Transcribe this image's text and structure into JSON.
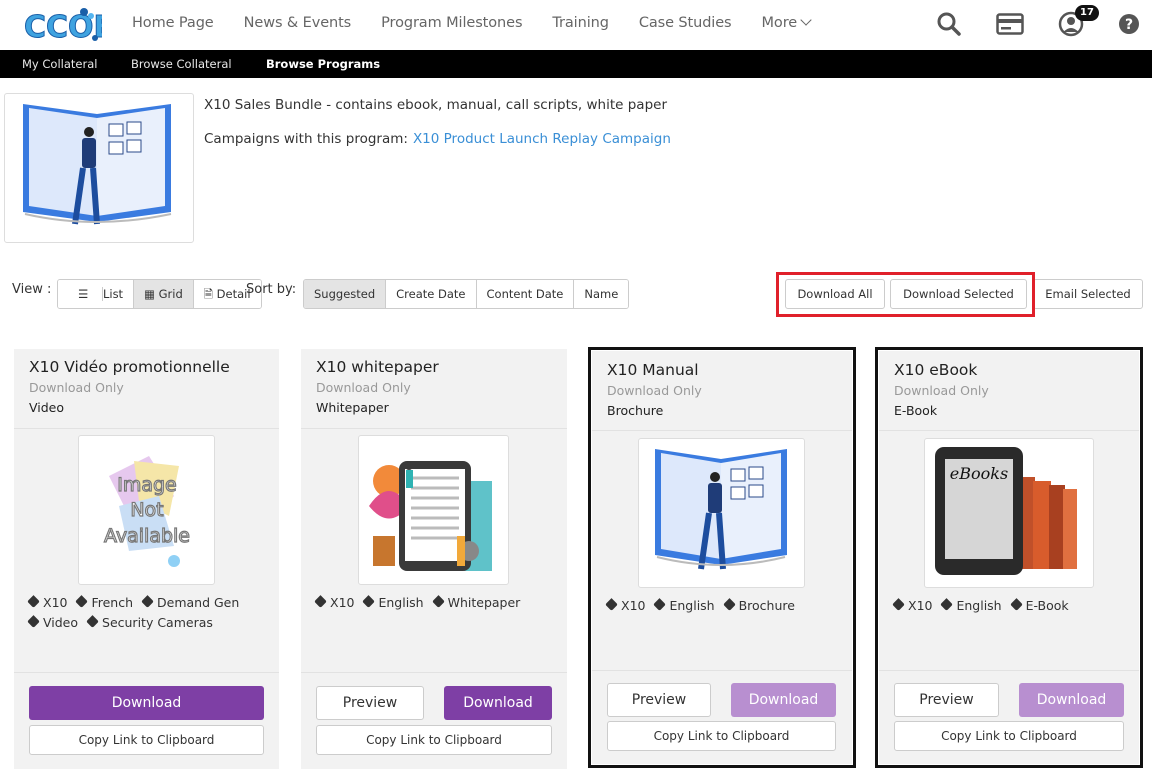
{
  "header": {
    "logo_text": "CCOE",
    "nav": [
      "Home Page",
      "News & Events",
      "Program Milestones",
      "Training",
      "Case Studies",
      "More"
    ],
    "notification_count": "17",
    "icons": [
      "search-icon",
      "card-icon",
      "user-icon",
      "help-icon"
    ]
  },
  "subnav": {
    "items": [
      "My Collateral",
      "Browse Collateral",
      "Browse Programs"
    ],
    "active": "Browse Programs"
  },
  "program": {
    "title": "X10 Sales Bundle - contains ebook, manual, call scripts, white paper",
    "campaign_label": "Campaigns with this program:",
    "campaign_link": "X10 Product Launch Replay Campaign"
  },
  "toolbar": {
    "view_label": "View :",
    "view_options": [
      "List",
      "Grid",
      "Detail"
    ],
    "view_selected": "Grid",
    "sort_label": "Sort by:",
    "sort_options": [
      "Suggested",
      "Create Date",
      "Content Date",
      "Name"
    ],
    "sort_selected": "Suggested",
    "download_all": "Download All",
    "download_selected": "Download Selected",
    "email_selected": "Email Selected"
  },
  "cards": [
    {
      "title": "X10 Vidéo promotionnelle",
      "mode": "Download Only",
      "type": "Video",
      "image_text": [
        "Image",
        "Not",
        "Available"
      ],
      "tags": [
        "X10",
        "French",
        "Demand Gen",
        "Video",
        "Security Cameras"
      ],
      "download": "Download",
      "copy": "Copy Link to Clipboard",
      "selected": false
    },
    {
      "title": "X10 whitepaper",
      "mode": "Download Only",
      "type": "Whitepaper",
      "tags": [
        "X10",
        "English",
        "Whitepaper"
      ],
      "preview": "Preview",
      "download": "Download",
      "copy": "Copy Link to Clipboard",
      "selected": false
    },
    {
      "title": "X10 Manual",
      "mode": "Download Only",
      "type": "Brochure",
      "tags": [
        "X10",
        "English",
        "Brochure"
      ],
      "preview": "Preview",
      "download": "Download",
      "copy": "Copy Link to Clipboard",
      "selected": true
    },
    {
      "title": "X10 eBook",
      "mode": "Download Only",
      "type": "E-Book",
      "image_text": "eBooks",
      "tags": [
        "X10",
        "English",
        "E-Book"
      ],
      "preview": "Preview",
      "download": "Download",
      "copy": "Copy Link to Clipboard",
      "selected": true
    }
  ],
  "colors": {
    "accent": "#7e3fa5",
    "accent_disabled": "#b88fd0",
    "link": "#3a8fd6",
    "highlight": "#e0202a"
  }
}
